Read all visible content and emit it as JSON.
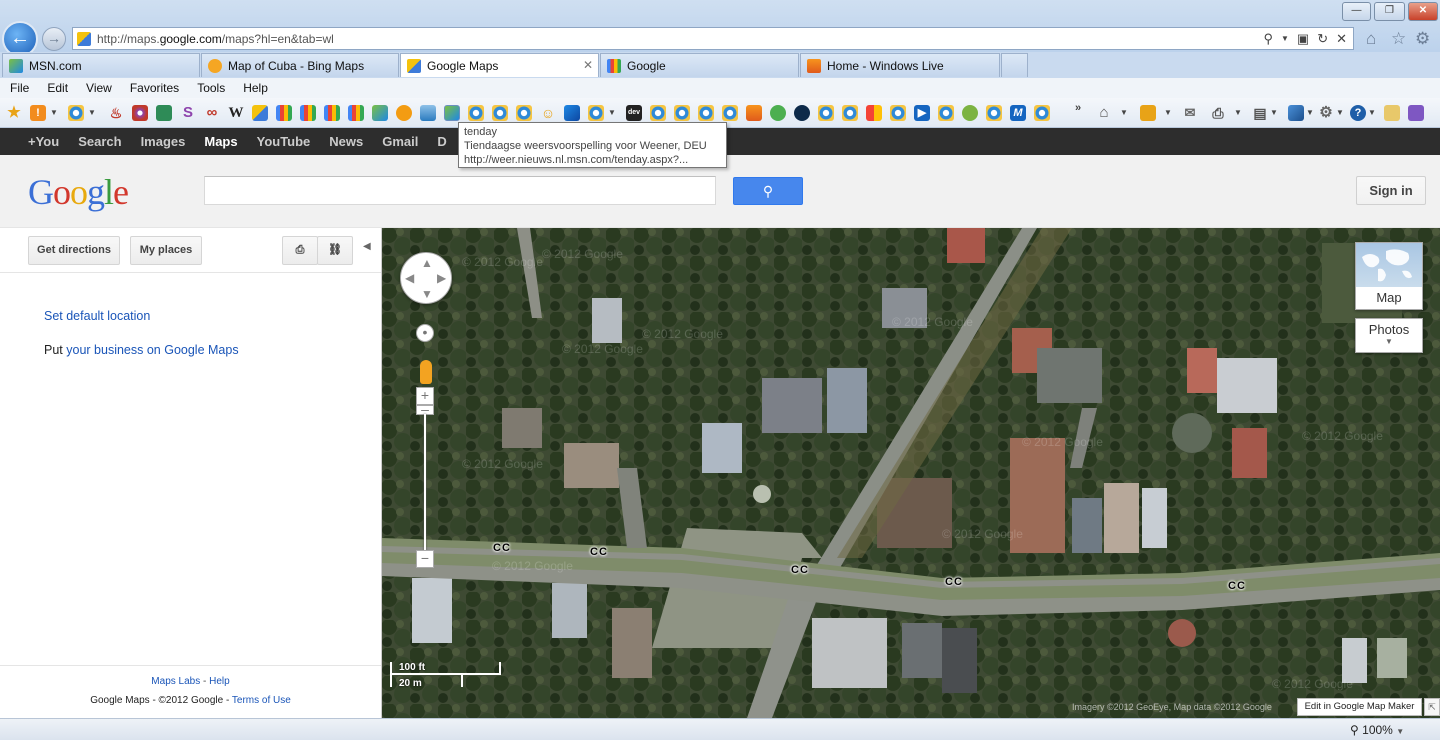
{
  "browser": {
    "url_prefix": "http://maps.",
    "url_domain": "google.com",
    "url_suffix": "/maps?hl=en&tab=wl",
    "tabs": [
      {
        "label": "MSN.com",
        "active": false
      },
      {
        "label": "Map of Cuba - Bing Maps",
        "active": false
      },
      {
        "label": "Google Maps",
        "active": true
      },
      {
        "label": "Google",
        "active": false
      },
      {
        "label": "Home - Windows Live",
        "active": false
      }
    ],
    "menu": [
      "File",
      "Edit",
      "View",
      "Favorites",
      "Tools",
      "Help"
    ],
    "tooltip": {
      "title": "tenday",
      "description": "Tiendaagse weersvoorspelling voor Weener, DEU",
      "url": "http://weer.nieuws.nl.msn.com/tenday.aspx?..."
    },
    "zoom": "100%"
  },
  "gbar": {
    "items": [
      "+You",
      "Search",
      "Images",
      "Maps",
      "YouTube",
      "News",
      "Gmail",
      "D"
    ],
    "active": "Maps"
  },
  "header": {
    "logo": "Google",
    "search_placeholder": "",
    "sign_in": "Sign in"
  },
  "panel": {
    "get_directions": "Get directions",
    "my_places": "My places",
    "set_default_location": "Set default location",
    "put_prefix": "Put ",
    "business_link": "your business on Google Maps",
    "maps_labs": "Maps Labs",
    "labs_sep": " - ",
    "help": "Help",
    "copyright": "Google Maps - ©2012 Google - ",
    "terms": "Terms of Use"
  },
  "map": {
    "road_labels": [
      "CC",
      "CC",
      "CC",
      "CC",
      "CC"
    ],
    "map_type": "Map",
    "photos": "Photos",
    "scale_ft": "100 ft",
    "scale_m": "20 m",
    "attribution": "Imagery ©2012 GeoEye, Map data ©2012 Google",
    "edit_link": "Edit in Google Map Maker"
  }
}
